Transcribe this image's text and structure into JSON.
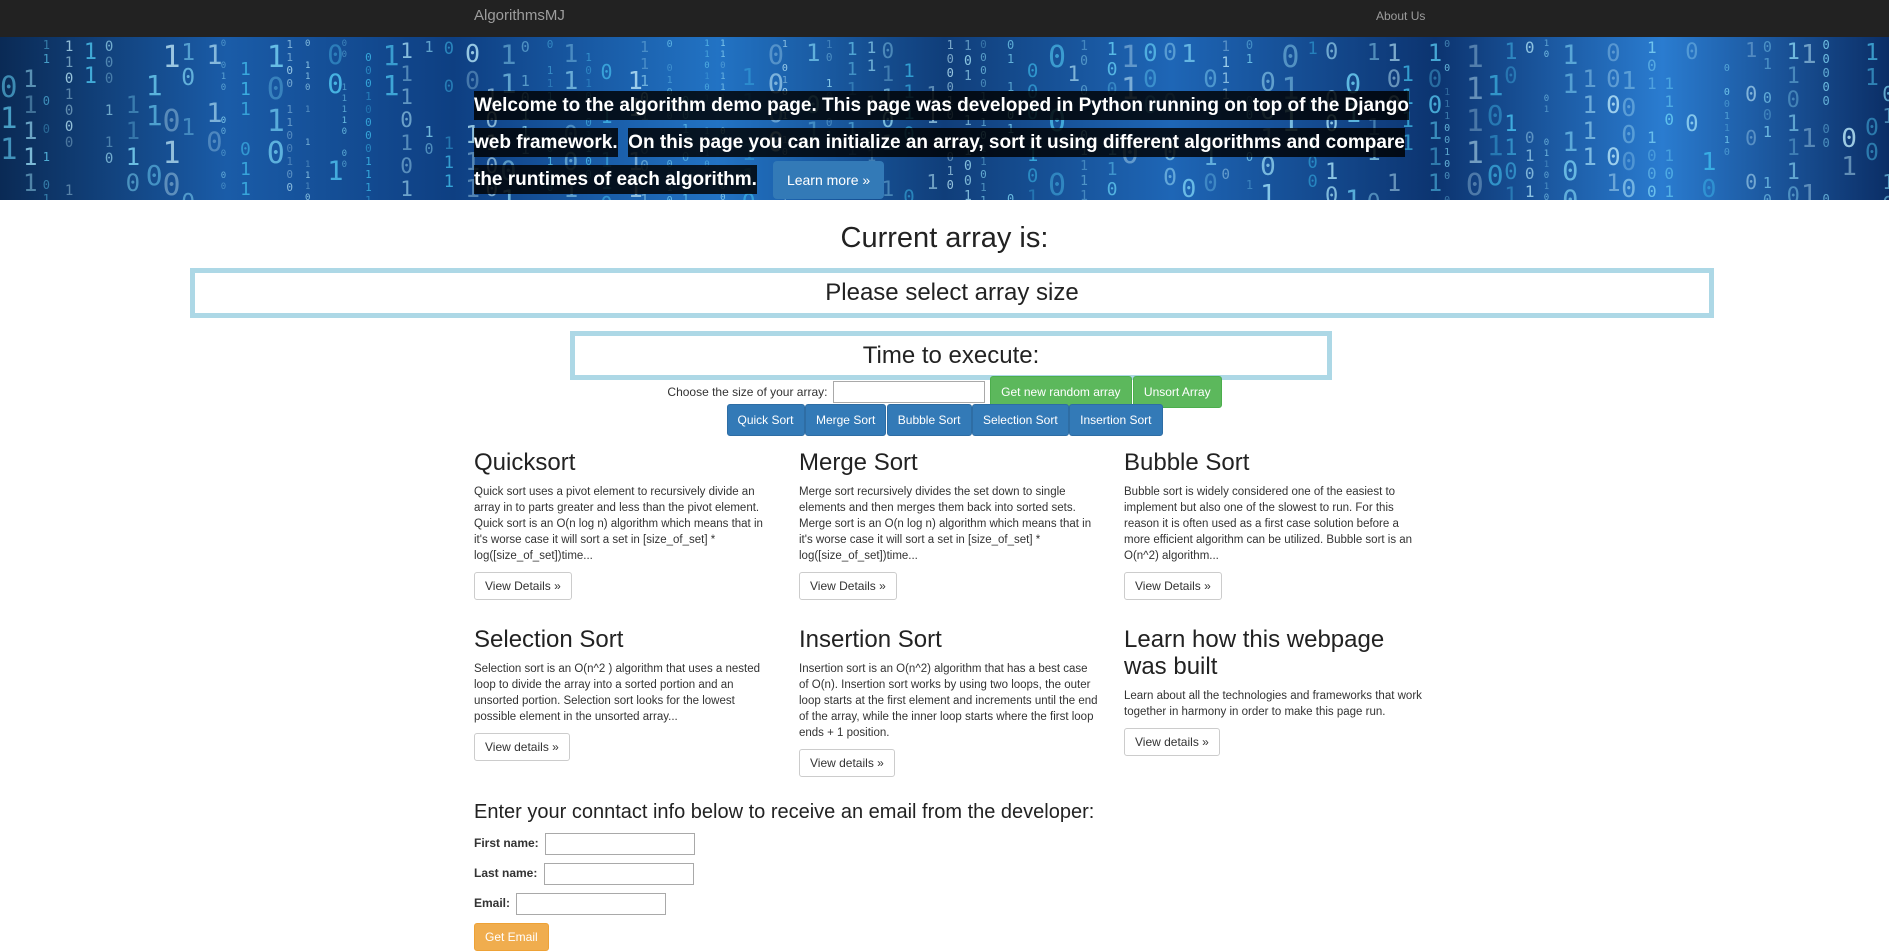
{
  "navbar": {
    "brand": "AlgorithmsMJ",
    "about": "About Us"
  },
  "hero": {
    "line1": "Welcome to the algorithm demo page. This page was developed in Python running on top of the Django web framework.",
    "line2": "On this page you can initialize an array, sort it using different algorithms and compare the runtimes of each algorithm.",
    "learn_more": "Learn more »"
  },
  "array": {
    "heading": "Current array is:",
    "value": "Please select array size",
    "time_heading": "Time to execute:"
  },
  "controls": {
    "size_label": "Choose the size of your array:",
    "size_value": "",
    "new_random": "Get new random array",
    "unsort": "Unsort Array",
    "sorts": [
      "Quick Sort",
      "Merge Sort",
      "Bubble Sort",
      "Selection Sort",
      "Insertion Sort"
    ]
  },
  "cards": [
    {
      "title": "Quicksort",
      "text": "Quick sort uses a pivot element to recursively divide an array in to parts greater and less than the pivot element. Quick sort is an O(n log n) algorithm which means that in it's worse case it will sort a set in [size_of_set] * log([size_of_set])time...",
      "button": "View Details »"
    },
    {
      "title": "Merge Sort",
      "text": "Merge sort recursively divides the set down to single elements and then merges them back into sorted sets. Merge sort is an O(n log n) algorithm which means that in it's worse case it will sort a set in [size_of_set] * log([size_of_set])time...",
      "button": "View Details »"
    },
    {
      "title": "Bubble Sort",
      "text": "Bubble sort is widely considered one of the easiest to implement but also one of the slowest to run. For this reason it is often used as a first case solution before a more efficient algorithm can be utilized. Bubble sort is an O(n^2) algorithm...",
      "button": "View Details »"
    },
    {
      "title": "Selection Sort",
      "text": "Selection sort is an O(n^2 ) algorithm that uses a nested loop to divide the array into a sorted portion and an unsorted portion. Selection sort looks for the lowest possible element in the unsorted array...",
      "button": "View details »"
    },
    {
      "title": "Insertion Sort",
      "text": "Insertion sort is an O(n^2) algorithm that has a best case of O(n). Insertion sort works by using two loops, the outer loop starts at the first element and increments until the end of the array, while the inner loop starts where the first loop ends + 1 position.",
      "button": "View details »"
    },
    {
      "title": "Learn how this webpage was built",
      "text": "Learn about all the technologies and frameworks that work together in harmony in order to make this page run.",
      "button": "View details »"
    }
  ],
  "contact": {
    "heading": "Enter your conntact info below to receive an email from the developer:",
    "first_label": "First name:",
    "last_label": "Last name:",
    "email_label": "Email:",
    "first_value": "",
    "last_value": "",
    "email_value": "",
    "submit": "Get Email"
  }
}
